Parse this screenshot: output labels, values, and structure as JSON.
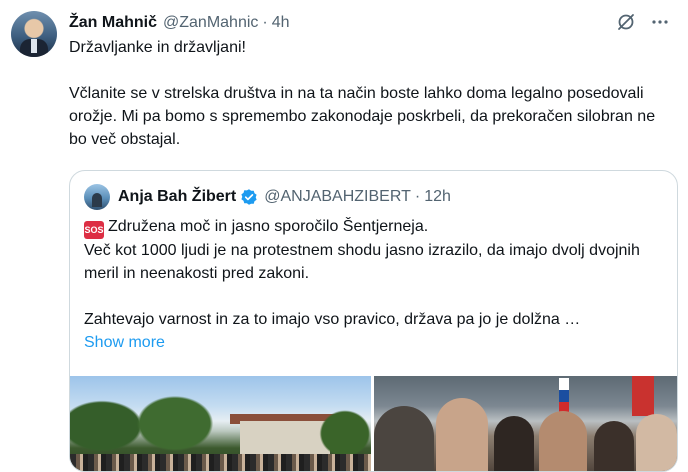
{
  "tweet": {
    "author_name": "Žan Mahnič",
    "author_handle": "@ZanMahnic",
    "separator": "·",
    "time": "4h",
    "lines": [
      "Državljanke in državljani!",
      "Včlanite se v strelska društva in na ta način boste lahko doma legalno posedovali orožje. Mi pa bomo s spremembo zakonodaje poskrbeli, da prekoračen silobran ne bo več obstajal."
    ]
  },
  "quoted": {
    "author_name": "Anja Bah Žibert",
    "author_handle": "@ANJABAHZIBERT",
    "separator": "·",
    "time": "12h",
    "emoji_label": "SOS",
    "line1": "Združena moč in jasno sporočilo Šentjerneja.",
    "line2": "Več kot 1000 ljudi je na protestnem shodu jasno izrazilo, da imajo dvolj dvojnih meril in neenakosti pred zakoni.",
    "line3": "Zahtevajo varnost in za to imajo vso pravico, država pa jo je dolžna …",
    "show_more": "Show more"
  },
  "icons": {
    "grok": "grok-icon",
    "more": "more-icon",
    "verified": "verified-icon",
    "sos": "sos-icon"
  },
  "colors": {
    "accent": "#1d9bf0",
    "text": "#0f1419",
    "secondary": "#536471",
    "border": "#cfd9de"
  }
}
